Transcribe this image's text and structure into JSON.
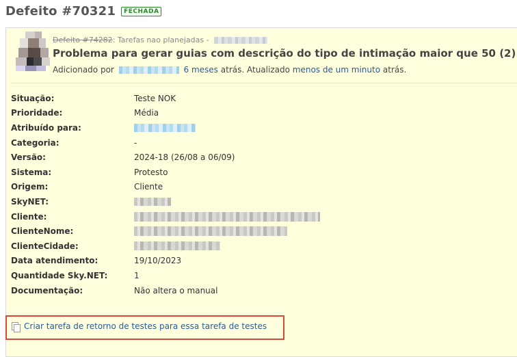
{
  "header": {
    "title": "Defeito #70321",
    "status": "FECHADA"
  },
  "issue": {
    "parent_link": "Defeito #74282",
    "parent_text": ": Tarefas nao planejadas -",
    "subject": "Problema para gerar guias com descrição do tipo de intimação maior que 50 (2)",
    "added_by_prefix": "Adicionado por",
    "added_ago": "6 meses",
    "updated_prefix": "atrás. Atualizado",
    "updated_ago": "menos de um minuto",
    "updated_suffix": "atrás."
  },
  "attributes": [
    {
      "label": "Situação:",
      "value": "Teste NOK"
    },
    {
      "label": "Prioridade:",
      "value": "Média"
    },
    {
      "label": "Atribuído para:",
      "value": ""
    },
    {
      "label": "Categoria:",
      "value": "-"
    },
    {
      "label": "Versão:",
      "value": "2024-18 (26/08 a 06/09)"
    },
    {
      "label": "Sistema:",
      "value": "Protesto"
    },
    {
      "label": "Origem:",
      "value": "Cliente"
    },
    {
      "label": "SkyNET:",
      "value": ""
    },
    {
      "label": "Cliente:",
      "value": ""
    },
    {
      "label": "ClienteNome:",
      "value": ""
    },
    {
      "label": "ClienteCidade:",
      "value": ""
    },
    {
      "label": "Data atendimento:",
      "value": "19/10/2023"
    },
    {
      "label": "Quantidade Sky.NET:",
      "value": "1"
    },
    {
      "label": "Documentação:",
      "value": "Não altera o manual"
    }
  ],
  "actions": {
    "create_return_task": "Criar tarefa de retorno de testes para essa tarefa de testes"
  },
  "icons": [
    "copy-icon"
  ],
  "colors": {
    "box_background": "#ffffdd",
    "link": "#2a5a9a",
    "status_green": "#2a8a2a",
    "highlight_red": "#d9483b"
  }
}
